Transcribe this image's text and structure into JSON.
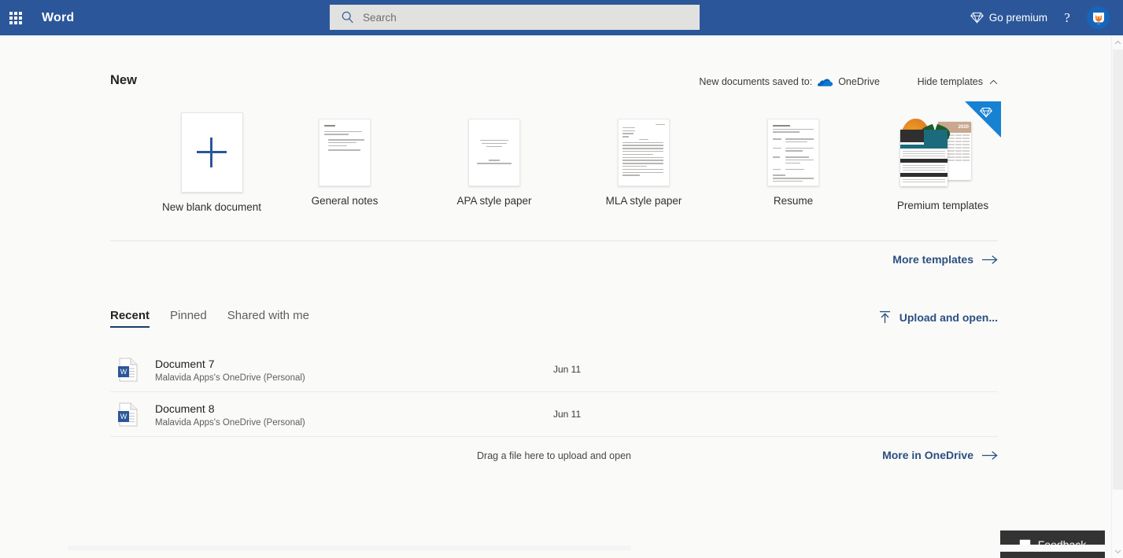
{
  "header": {
    "app_title": "Word",
    "waffle_icon": "app-launcher-grid-icon",
    "search": {
      "placeholder": "Search",
      "value": "",
      "icon": "search-icon"
    },
    "go_premium": {
      "label": "Go premium",
      "icon": "diamond-icon"
    },
    "help": {
      "label": "?",
      "icon": "question-mark-icon"
    },
    "avatar": {
      "name": "malavida-fox-avatar"
    },
    "background_color": "#2b579a"
  },
  "new_section": {
    "title": "New",
    "saved_to_label": "New documents saved to:",
    "saved_to_service": "OneDrive",
    "onedrive_icon": "onedrive-cloud-icon",
    "hide_templates_label": "Hide templates",
    "hide_templates_icon": "chevron-up-icon",
    "templates": [
      {
        "label": "New blank document",
        "kind": "blank"
      },
      {
        "label": "General notes",
        "kind": "notes"
      },
      {
        "label": "APA style paper",
        "kind": "apa"
      },
      {
        "label": "MLA style paper",
        "kind": "mla"
      },
      {
        "label": "Resume",
        "kind": "resume"
      },
      {
        "label": "Premium templates",
        "kind": "premium",
        "badge": "premium-diamond-badge",
        "calendar_year": "2020"
      }
    ],
    "more_templates_label": "More templates",
    "more_templates_icon": "arrow-right-icon"
  },
  "recent_section": {
    "tabs": [
      {
        "label": "Recent",
        "active": true
      },
      {
        "label": "Pinned",
        "active": false
      },
      {
        "label": "Shared with me",
        "active": false
      }
    ],
    "upload_and_open_label": "Upload and open...",
    "upload_icon": "upload-arrow-icon",
    "documents": [
      {
        "name": "Document 7",
        "location": "Malavida Apps's OneDrive (Personal)",
        "date": "Jun 11",
        "icon": "word-document-icon"
      },
      {
        "name": "Document 8",
        "location": "Malavida Apps's OneDrive (Personal)",
        "date": "Jun 11",
        "icon": "word-document-icon"
      }
    ],
    "drag_hint": "Drag a file here to upload and open",
    "more_in_onedrive_label": "More in OneDrive",
    "more_in_onedrive_icon": "arrow-right-icon"
  },
  "feedback": {
    "label": "Feedback",
    "icon": "speech-bubble-icon"
  },
  "colors": {
    "header_blue": "#2b579a",
    "link_blue": "#2b4f81",
    "premium_badge_blue": "#1781d2",
    "page_bg": "#fafaf9",
    "feedback_bg": "#333333"
  }
}
